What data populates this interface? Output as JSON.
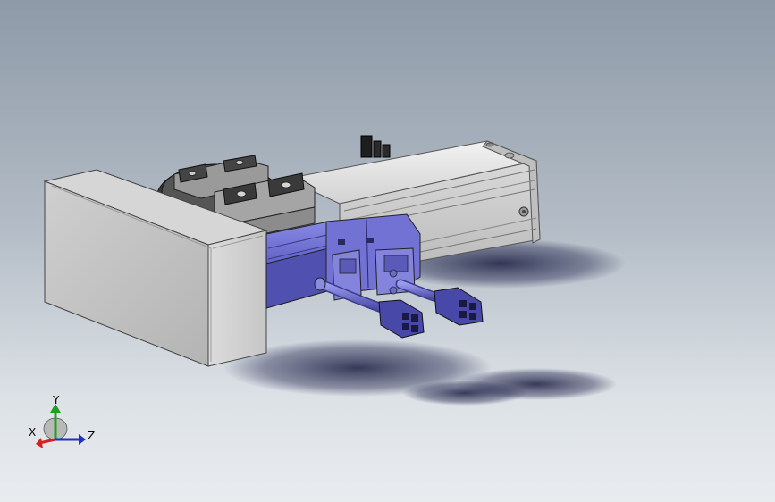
{
  "viewport": {
    "background_top": "#8e9aa8",
    "background_bottom": "#e9ecef"
  },
  "model": {
    "housing_color": "#c8c8c8",
    "motor_color": "#6666cc",
    "connector_color": "#5555b0"
  },
  "triad": {
    "x_label": "X",
    "y_label": "Y",
    "z_label": "Z",
    "x_color": "#d62020",
    "y_color": "#20a020",
    "z_color": "#2030c0"
  }
}
